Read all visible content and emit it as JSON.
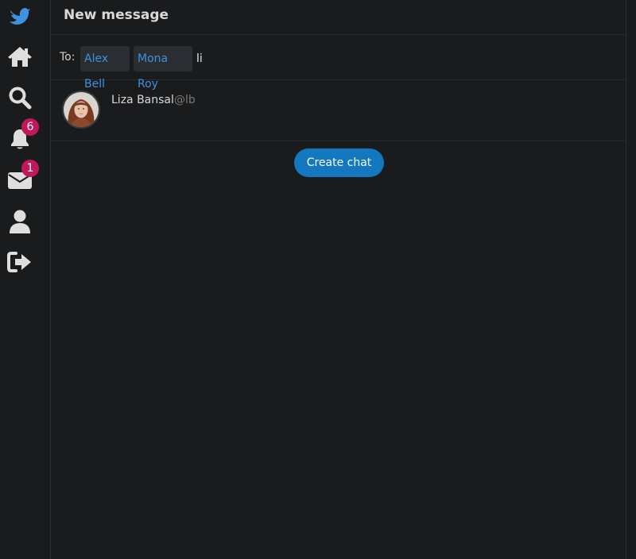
{
  "sidebar": {
    "items": [
      {
        "icon": "bird-logo-icon",
        "color": "#3d93e0"
      },
      {
        "icon": "home-icon"
      },
      {
        "icon": "search-icon"
      },
      {
        "icon": "bell-icon",
        "badge": "6"
      },
      {
        "icon": "envelope-icon",
        "badge": "1"
      },
      {
        "icon": "user-icon"
      },
      {
        "icon": "sign-out-icon"
      }
    ]
  },
  "header": {
    "title": "New message"
  },
  "to_field": {
    "label": "To:",
    "recipients": [
      "Alex Bell",
      "Mona Roy"
    ],
    "input_value": "li"
  },
  "results": [
    {
      "name": "Liza Bansal",
      "handle": "@lb"
    }
  ],
  "create_chat": {
    "label": "Create chat"
  },
  "colors": {
    "background": "#1a1b1d",
    "accent": "#3d93e0",
    "button": "#1378c0",
    "badge": "#c2185b",
    "divider": "#2c2d30"
  }
}
